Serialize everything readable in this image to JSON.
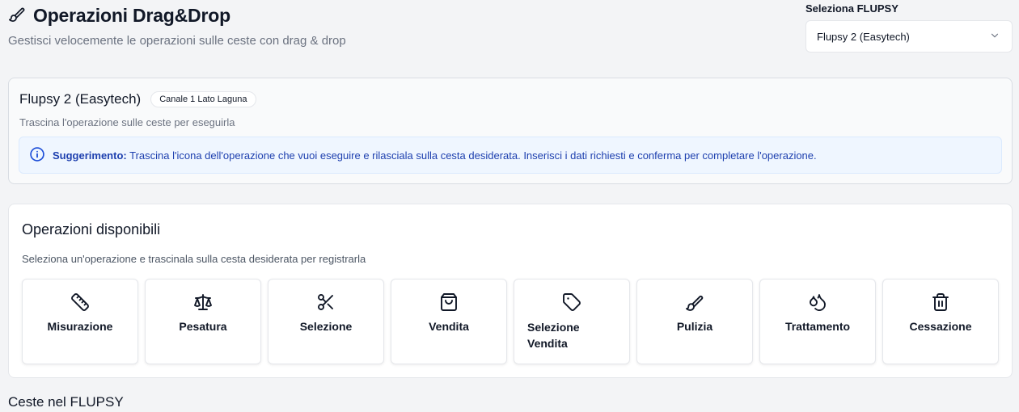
{
  "header": {
    "title": "Operazioni Drag&Drop",
    "subtitle": "Gestisci velocemente le operazioni sulle ceste con drag & drop",
    "icon": "brush-icon"
  },
  "flupsy_select": {
    "label": "Seleziona FLUPSY",
    "value": "Flupsy 2 (Easytech)"
  },
  "info": {
    "name": "Flupsy 2 (Easytech)",
    "badge": "Canale 1 Lato Laguna",
    "subtitle": "Trascina l'operazione sulle ceste per eseguirla",
    "tip_strong": "Suggerimento:",
    "tip_text": "Trascina l'icona dell'operazione che vuoi eseguire e rilasciala sulla cesta desiderata. Inserisci i dati richiesti e conferma per completare l'operazione."
  },
  "operations": {
    "title": "Operazioni disponibili",
    "subtitle": "Seleziona un'operazione e trascinala sulla cesta desiderata per registrarla",
    "items": [
      {
        "label": "Misurazione",
        "icon": "ruler-icon"
      },
      {
        "label": "Pesatura",
        "icon": "scale-icon"
      },
      {
        "label": "Selezione",
        "icon": "scissors-icon"
      },
      {
        "label": "Vendita",
        "icon": "shopping-bag-icon"
      },
      {
        "label": "Selezione Vendita",
        "icon": "tag-icon"
      },
      {
        "label": "Pulizia",
        "icon": "brush-icon"
      },
      {
        "label": "Trattamento",
        "icon": "droplets-icon"
      },
      {
        "label": "Cessazione",
        "icon": "trash-icon"
      }
    ]
  },
  "baskets_section": {
    "title": "Ceste nel FLUPSY"
  },
  "colors": {
    "background": "#f3f4f6",
    "tip_background": "#eff6ff",
    "tip_text": "#1e40af"
  }
}
